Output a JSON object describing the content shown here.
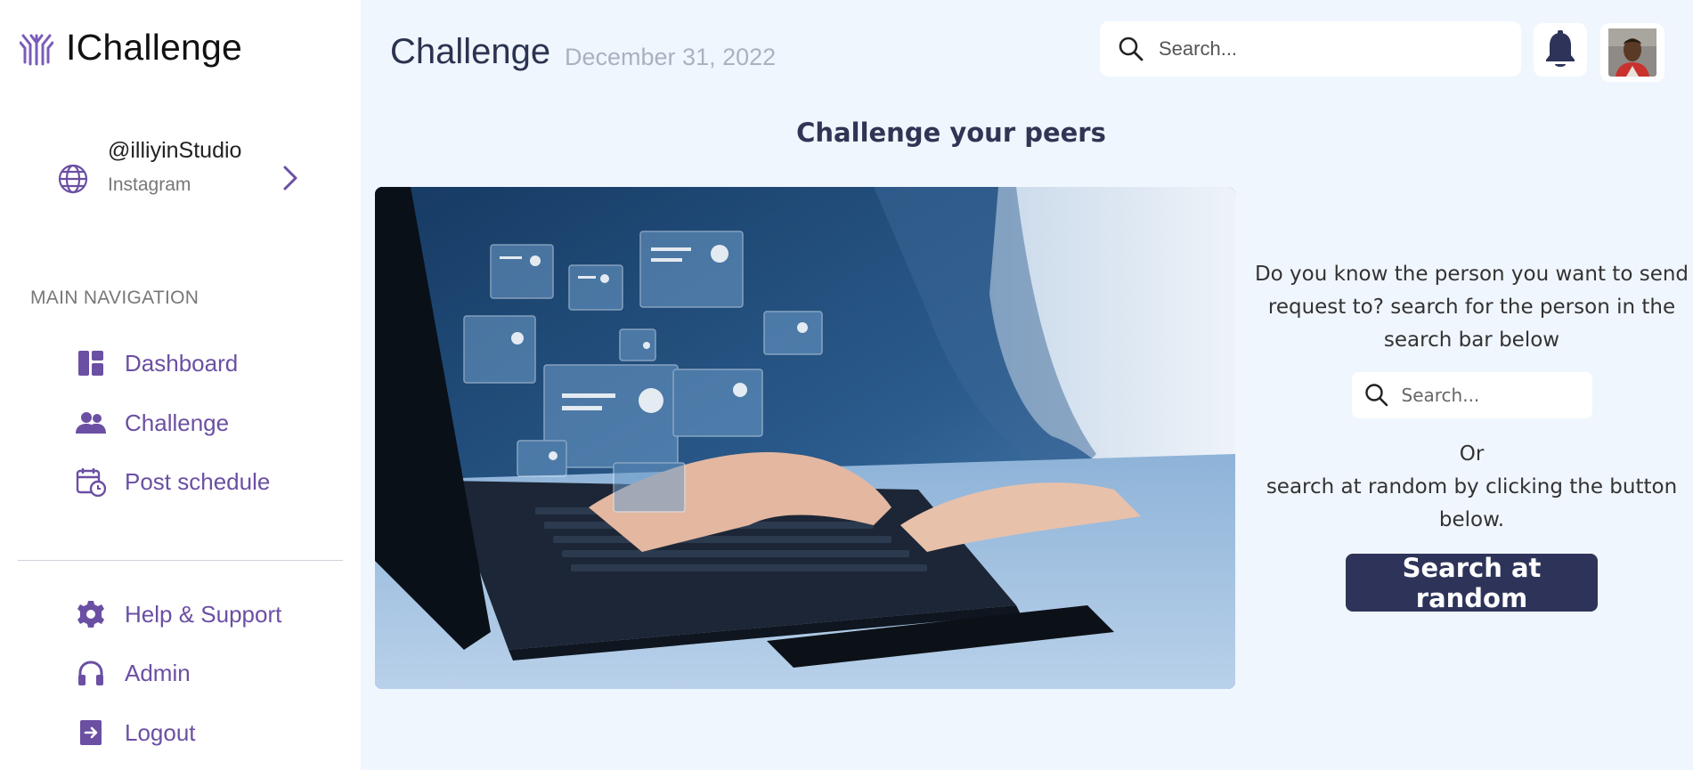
{
  "brand": {
    "name": "IChallenge"
  },
  "account": {
    "handle": "@illiyinStudio",
    "platform": "Instagram"
  },
  "sidebar": {
    "nav_heading": "MAIN NAVIGATION",
    "main_items": [
      {
        "label": "Dashboard",
        "icon": "dashboard-icon"
      },
      {
        "label": "Challenge",
        "icon": "people-icon"
      },
      {
        "label": "Post schedule",
        "icon": "calendar-clock-icon"
      }
    ],
    "bottom_items": [
      {
        "label": "Help & Support",
        "icon": "gear-icon"
      },
      {
        "label": "Admin",
        "icon": "headphones-icon"
      },
      {
        "label": "Logout",
        "icon": "logout-icon"
      }
    ]
  },
  "header": {
    "title": "Challenge",
    "date": "December 31, 2022",
    "search_placeholder": "Search..."
  },
  "main": {
    "section_title": "Challenge your peers",
    "intro_text": "Do you know the person you want to send request to? search for the person in the search bar below",
    "search_placeholder": "Search...",
    "or_label": "Or",
    "random_text": "search at random by clicking the button below.",
    "random_button": "Search at random"
  },
  "colors": {
    "accent": "#6b4fa3",
    "navy": "#2e3459",
    "background": "#f0f6fe"
  }
}
